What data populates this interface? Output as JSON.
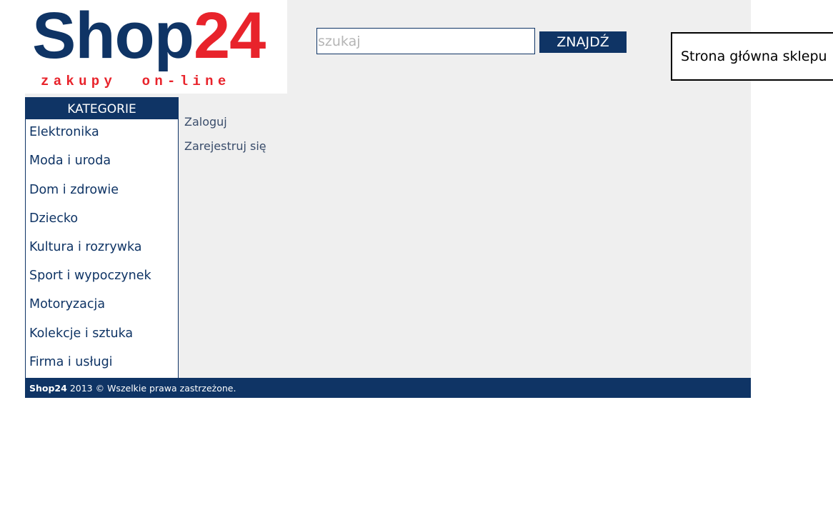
{
  "logo": {
    "name_part1": "Shop",
    "name_part2": "24",
    "tagline": "zakupy  on-line",
    "color_primary": "#0f3465",
    "color_accent": "#e8232b"
  },
  "search": {
    "placeholder": "szukaj",
    "value": "",
    "button_label": "ZNAJDŹ"
  },
  "annotation": {
    "text": "Strona główna sklepu"
  },
  "sidebar": {
    "header": "KATEGORIE",
    "items": [
      {
        "label": "Elektronika"
      },
      {
        "label": "Moda i uroda"
      },
      {
        "label": "Dom i zdrowie"
      },
      {
        "label": "Dziecko"
      },
      {
        "label": "Kultura i rozrywka"
      },
      {
        "label": "Sport i wypoczynek"
      },
      {
        "label": "Motoryzacja"
      },
      {
        "label": "Kolekcje i sztuka"
      },
      {
        "label": "Firma i usługi"
      }
    ]
  },
  "account": {
    "login_label": "Zaloguj",
    "register_label": "Zarejestruj się"
  },
  "footer": {
    "brand": "Shop24",
    "text": " 2013 © Wszelkie prawa zastrzeżone."
  },
  "colors": {
    "navy": "#0f3465",
    "red": "#e8232b",
    "panel_grey": "#efefef"
  }
}
